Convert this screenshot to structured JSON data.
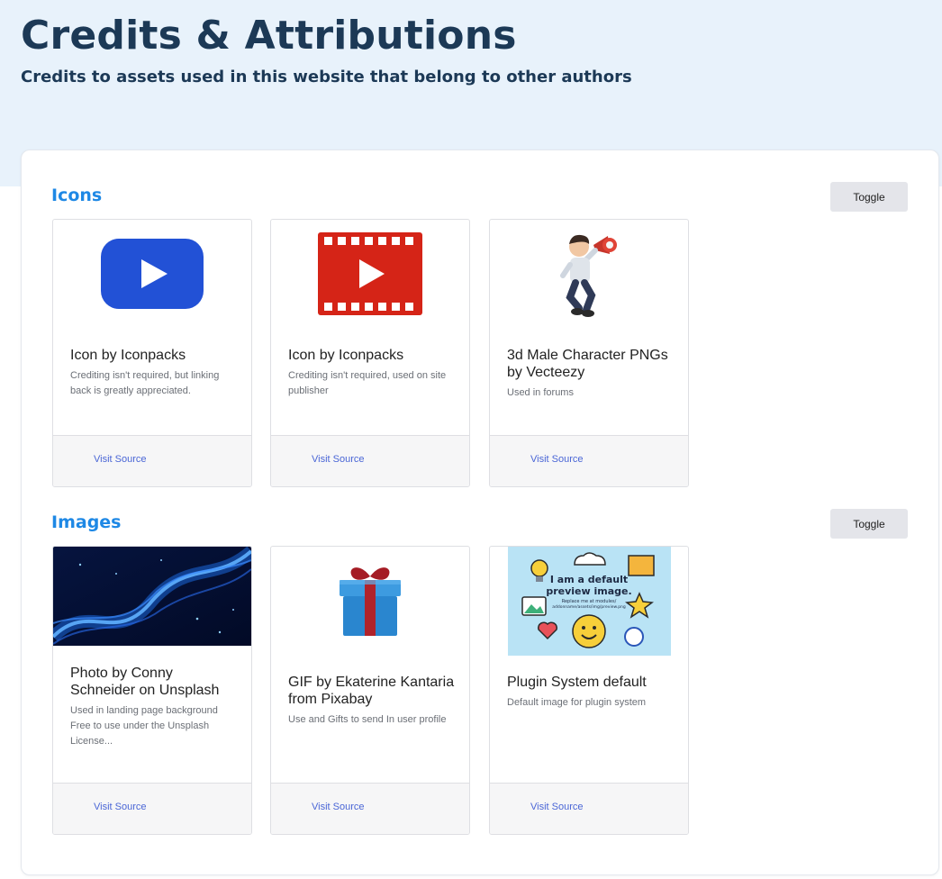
{
  "header": {
    "title": "Credits & Attributions",
    "subtitle": "Credits to assets used in this website that belong to other authors"
  },
  "sections": [
    {
      "title": "Icons",
      "toggle_label": "Toggle",
      "cards": [
        {
          "title": "Icon by Iconpacks",
          "description": "Crediting isn't required, but linking back is greatly appreciated.",
          "link_label": "Visit Source",
          "image": "youtube-play-icon"
        },
        {
          "title": "Icon by Iconpacks",
          "description": "Crediting isn't required, used on site publisher",
          "link_label": "Visit Source",
          "image": "video-film-icon"
        },
        {
          "title": "3d Male Character PNGs by Vecteezy",
          "description": "Used in forums",
          "link_label": "Visit Source",
          "image": "megaphone-character-image"
        }
      ]
    },
    {
      "title": "Images",
      "toggle_label": "Toggle",
      "cards": [
        {
          "title": "Photo by Conny Schneider on Unsplash",
          "description": "Used in landing page background Free to use under the Unsplash License...",
          "link_label": "Visit Source",
          "image": "blue-network-photo"
        },
        {
          "title": "GIF by Ekaterine Kantaria from Pixabay",
          "description": "Use and Gifts to send In user profile",
          "link_label": "Visit Source",
          "image": "gift-box-image"
        },
        {
          "title": "Plugin System default",
          "description": "Default image for plugin system",
          "link_label": "Visit Source",
          "image": "default-preview-image",
          "preview_text": {
            "line1": "I am a default",
            "line2": "preview image.",
            "line3": "Replace me at modules/",
            "line4": "addonname/assets/img/preview.png"
          }
        }
      ]
    }
  ],
  "colors": {
    "accent": "#1e88e5",
    "heading": "#1c3956",
    "hero_bg": "#e8f2fb",
    "link": "#4a66d6"
  }
}
